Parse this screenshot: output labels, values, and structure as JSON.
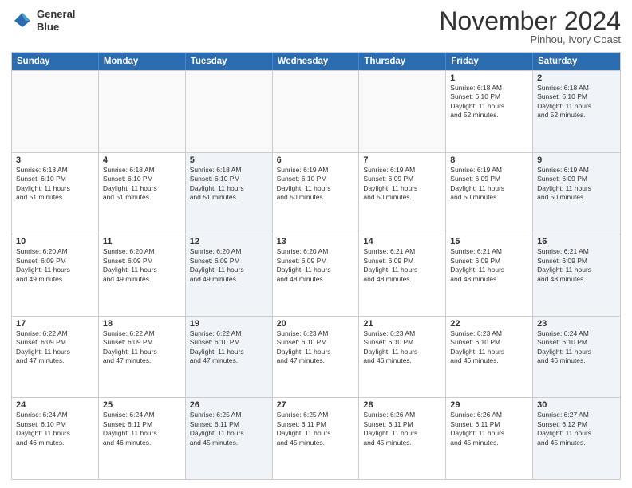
{
  "logo": {
    "line1": "General",
    "line2": "Blue"
  },
  "title": "November 2024",
  "location": "Pinhou, Ivory Coast",
  "header": {
    "days": [
      "Sunday",
      "Monday",
      "Tuesday",
      "Wednesday",
      "Thursday",
      "Friday",
      "Saturday"
    ]
  },
  "rows": [
    {
      "cells": [
        {
          "empty": true
        },
        {
          "empty": true
        },
        {
          "empty": true
        },
        {
          "empty": true
        },
        {
          "empty": true
        },
        {
          "day": "1",
          "lines": [
            "Sunrise: 6:18 AM",
            "Sunset: 6:10 PM",
            "Daylight: 11 hours",
            "and 52 minutes."
          ]
        },
        {
          "day": "2",
          "alt": true,
          "lines": [
            "Sunrise: 6:18 AM",
            "Sunset: 6:10 PM",
            "Daylight: 11 hours",
            "and 52 minutes."
          ]
        }
      ]
    },
    {
      "cells": [
        {
          "day": "3",
          "lines": [
            "Sunrise: 6:18 AM",
            "Sunset: 6:10 PM",
            "Daylight: 11 hours",
            "and 51 minutes."
          ]
        },
        {
          "day": "4",
          "lines": [
            "Sunrise: 6:18 AM",
            "Sunset: 6:10 PM",
            "Daylight: 11 hours",
            "and 51 minutes."
          ]
        },
        {
          "day": "5",
          "alt": true,
          "lines": [
            "Sunrise: 6:18 AM",
            "Sunset: 6:10 PM",
            "Daylight: 11 hours",
            "and 51 minutes."
          ]
        },
        {
          "day": "6",
          "lines": [
            "Sunrise: 6:19 AM",
            "Sunset: 6:10 PM",
            "Daylight: 11 hours",
            "and 50 minutes."
          ]
        },
        {
          "day": "7",
          "lines": [
            "Sunrise: 6:19 AM",
            "Sunset: 6:09 PM",
            "Daylight: 11 hours",
            "and 50 minutes."
          ]
        },
        {
          "day": "8",
          "lines": [
            "Sunrise: 6:19 AM",
            "Sunset: 6:09 PM",
            "Daylight: 11 hours",
            "and 50 minutes."
          ]
        },
        {
          "day": "9",
          "alt": true,
          "lines": [
            "Sunrise: 6:19 AM",
            "Sunset: 6:09 PM",
            "Daylight: 11 hours",
            "and 50 minutes."
          ]
        }
      ]
    },
    {
      "cells": [
        {
          "day": "10",
          "lines": [
            "Sunrise: 6:20 AM",
            "Sunset: 6:09 PM",
            "Daylight: 11 hours",
            "and 49 minutes."
          ]
        },
        {
          "day": "11",
          "lines": [
            "Sunrise: 6:20 AM",
            "Sunset: 6:09 PM",
            "Daylight: 11 hours",
            "and 49 minutes."
          ]
        },
        {
          "day": "12",
          "alt": true,
          "lines": [
            "Sunrise: 6:20 AM",
            "Sunset: 6:09 PM",
            "Daylight: 11 hours",
            "and 49 minutes."
          ]
        },
        {
          "day": "13",
          "lines": [
            "Sunrise: 6:20 AM",
            "Sunset: 6:09 PM",
            "Daylight: 11 hours",
            "and 48 minutes."
          ]
        },
        {
          "day": "14",
          "lines": [
            "Sunrise: 6:21 AM",
            "Sunset: 6:09 PM",
            "Daylight: 11 hours",
            "and 48 minutes."
          ]
        },
        {
          "day": "15",
          "lines": [
            "Sunrise: 6:21 AM",
            "Sunset: 6:09 PM",
            "Daylight: 11 hours",
            "and 48 minutes."
          ]
        },
        {
          "day": "16",
          "alt": true,
          "lines": [
            "Sunrise: 6:21 AM",
            "Sunset: 6:09 PM",
            "Daylight: 11 hours",
            "and 48 minutes."
          ]
        }
      ]
    },
    {
      "cells": [
        {
          "day": "17",
          "lines": [
            "Sunrise: 6:22 AM",
            "Sunset: 6:09 PM",
            "Daylight: 11 hours",
            "and 47 minutes."
          ]
        },
        {
          "day": "18",
          "lines": [
            "Sunrise: 6:22 AM",
            "Sunset: 6:09 PM",
            "Daylight: 11 hours",
            "and 47 minutes."
          ]
        },
        {
          "day": "19",
          "alt": true,
          "lines": [
            "Sunrise: 6:22 AM",
            "Sunset: 6:10 PM",
            "Daylight: 11 hours",
            "and 47 minutes."
          ]
        },
        {
          "day": "20",
          "lines": [
            "Sunrise: 6:23 AM",
            "Sunset: 6:10 PM",
            "Daylight: 11 hours",
            "and 47 minutes."
          ]
        },
        {
          "day": "21",
          "lines": [
            "Sunrise: 6:23 AM",
            "Sunset: 6:10 PM",
            "Daylight: 11 hours",
            "and 46 minutes."
          ]
        },
        {
          "day": "22",
          "lines": [
            "Sunrise: 6:23 AM",
            "Sunset: 6:10 PM",
            "Daylight: 11 hours",
            "and 46 minutes."
          ]
        },
        {
          "day": "23",
          "alt": true,
          "lines": [
            "Sunrise: 6:24 AM",
            "Sunset: 6:10 PM",
            "Daylight: 11 hours",
            "and 46 minutes."
          ]
        }
      ]
    },
    {
      "cells": [
        {
          "day": "24",
          "lines": [
            "Sunrise: 6:24 AM",
            "Sunset: 6:10 PM",
            "Daylight: 11 hours",
            "and 46 minutes."
          ]
        },
        {
          "day": "25",
          "lines": [
            "Sunrise: 6:24 AM",
            "Sunset: 6:11 PM",
            "Daylight: 11 hours",
            "and 46 minutes."
          ]
        },
        {
          "day": "26",
          "alt": true,
          "lines": [
            "Sunrise: 6:25 AM",
            "Sunset: 6:11 PM",
            "Daylight: 11 hours",
            "and 45 minutes."
          ]
        },
        {
          "day": "27",
          "lines": [
            "Sunrise: 6:25 AM",
            "Sunset: 6:11 PM",
            "Daylight: 11 hours",
            "and 45 minutes."
          ]
        },
        {
          "day": "28",
          "lines": [
            "Sunrise: 6:26 AM",
            "Sunset: 6:11 PM",
            "Daylight: 11 hours",
            "and 45 minutes."
          ]
        },
        {
          "day": "29",
          "lines": [
            "Sunrise: 6:26 AM",
            "Sunset: 6:11 PM",
            "Daylight: 11 hours",
            "and 45 minutes."
          ]
        },
        {
          "day": "30",
          "alt": true,
          "lines": [
            "Sunrise: 6:27 AM",
            "Sunset: 6:12 PM",
            "Daylight: 11 hours",
            "and 45 minutes."
          ]
        }
      ]
    }
  ]
}
